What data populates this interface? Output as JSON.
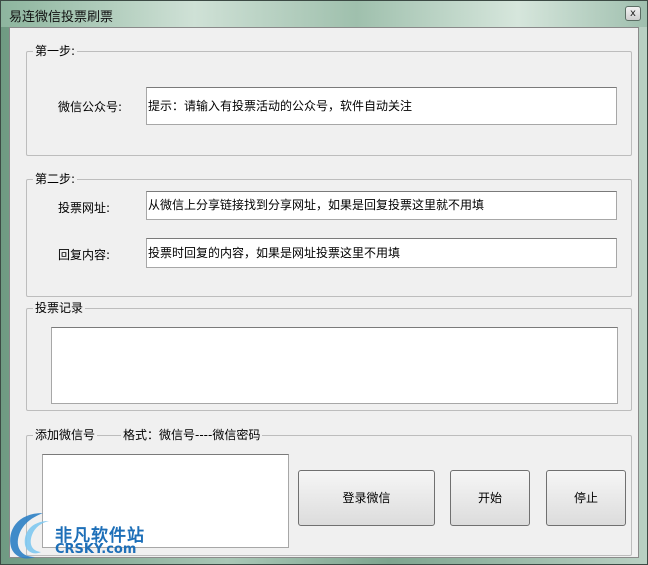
{
  "window": {
    "title": "易连微信投票刷票",
    "close_glyph": "x"
  },
  "step1": {
    "group_label": "第一步:",
    "account_label": "微信公众号:",
    "account_value": "提示：请输入有投票活动的公众号，软件自动关注"
  },
  "step2": {
    "group_label": "第二步:",
    "url_label": "投票网址:",
    "url_value": "从微信上分享链接找到分享网址，如果是回复投票这里就不用填",
    "reply_label": "回复内容:",
    "reply_value": "投票时回复的内容，如果是网址投票这里不用填"
  },
  "record": {
    "group_label": "投票记录",
    "value": ""
  },
  "add_account": {
    "group_label": "添加微信号",
    "format_label": "格式：微信号----微信密码",
    "value": "",
    "login_button": "登录微信",
    "start_button": "开始",
    "stop_button": "停止"
  },
  "watermark": {
    "brand": "非凡软件站",
    "domain": "CRSKY.com",
    "color": "#1d6fb8"
  }
}
